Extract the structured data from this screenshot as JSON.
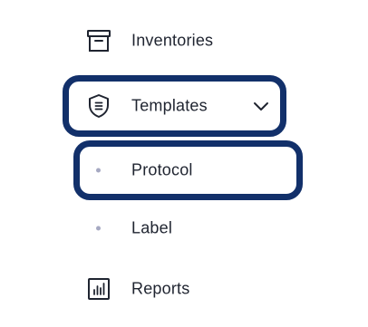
{
  "nav": {
    "items": [
      {
        "label": "Inventories",
        "icon": "archive-box-icon"
      },
      {
        "label": "Templates",
        "icon": "shield-list-icon",
        "expanded": true,
        "toggle_icon": "chevron-down-icon"
      },
      {
        "label": "Protocol",
        "icon": "bullet-dot",
        "highlighted": true
      },
      {
        "label": "Label",
        "icon": "bullet-dot"
      },
      {
        "label": "Reports",
        "icon": "bar-chart-icon"
      }
    ]
  },
  "colors": {
    "text": "#1f2430",
    "highlight_border": "#12306a",
    "bullet": "#a6a9c2",
    "background": "#ffffff"
  }
}
